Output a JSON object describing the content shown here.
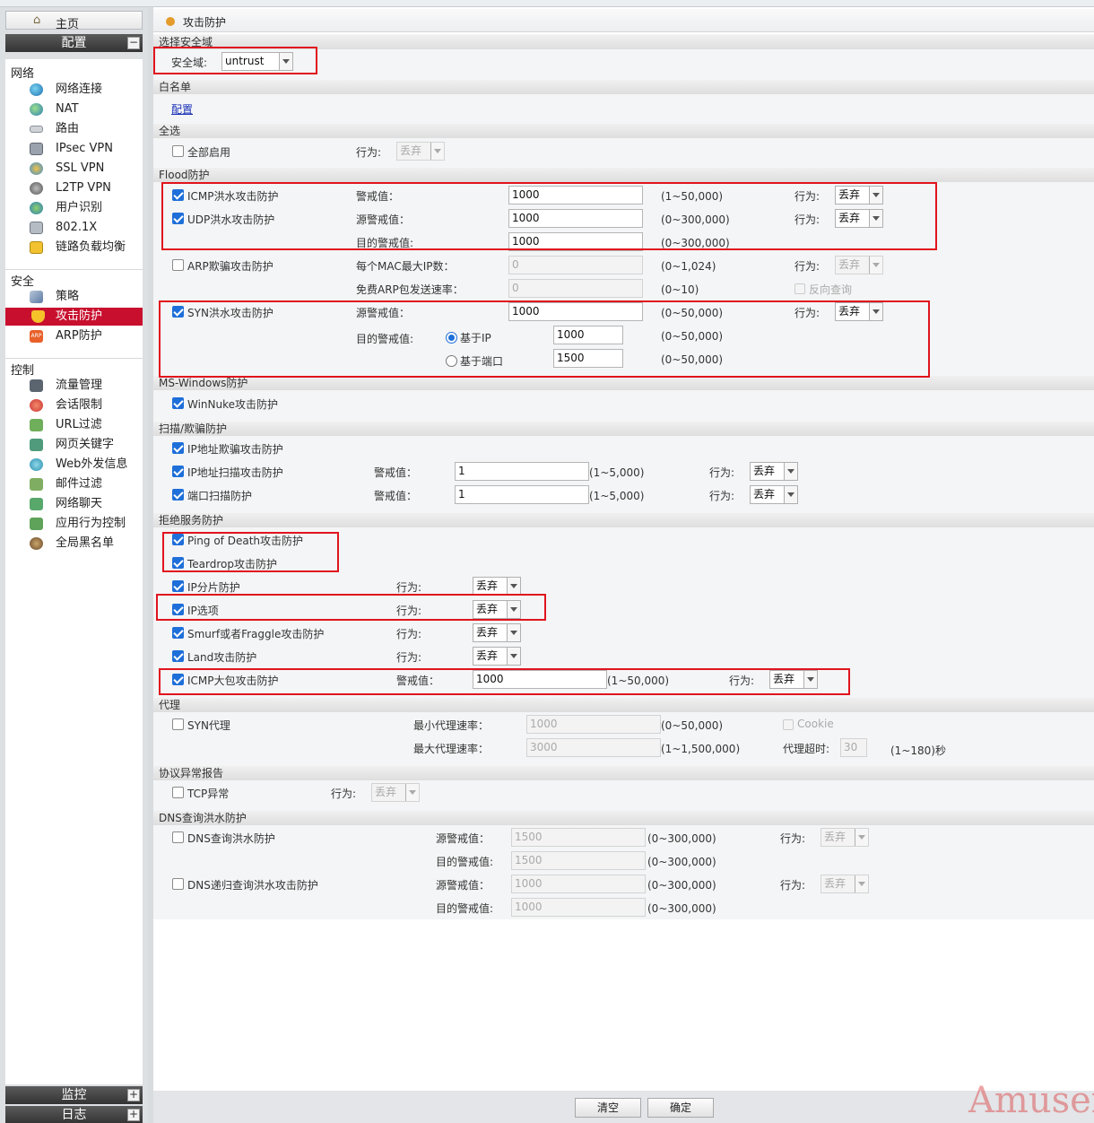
{
  "sidebar": {
    "home": "主页",
    "config_header": "配置",
    "groups": {
      "network": "网络",
      "security": "安全",
      "control": "控制"
    },
    "network_items": [
      {
        "label": "网络连接"
      },
      {
        "label": "NAT"
      },
      {
        "label": "路由"
      },
      {
        "label": "IPsec VPN"
      },
      {
        "label": "SSL VPN"
      },
      {
        "label": "L2TP VPN"
      },
      {
        "label": "用户识别"
      },
      {
        "label": "802.1X"
      },
      {
        "label": "链路负载均衡"
      }
    ],
    "security_items": [
      {
        "label": "策略"
      },
      {
        "label": "攻击防护"
      },
      {
        "label": "ARP防护"
      }
    ],
    "control_items": [
      {
        "label": "流量管理"
      },
      {
        "label": "会话限制"
      },
      {
        "label": "URL过滤"
      },
      {
        "label": "网页关键字"
      },
      {
        "label": "Web外发信息"
      },
      {
        "label": "邮件过滤"
      },
      {
        "label": "网络聊天"
      },
      {
        "label": "应用行为控制"
      },
      {
        "label": "全局黑名单"
      }
    ],
    "monitor_header": "监控",
    "log_header": "日志",
    "plus": "+",
    "minus": "−"
  },
  "main": {
    "title": "攻击防护",
    "zone": {
      "section": "选择安全域",
      "label": "安全域:",
      "value": "untrust"
    },
    "whitelist": {
      "section": "白名单",
      "link": "配置"
    },
    "all": {
      "section": "全选",
      "label": "全部启用",
      "action_label": "行为:",
      "action": "丢弃"
    },
    "flood": {
      "section": "Flood防护",
      "icmp": {
        "label": "ICMP洪水攻击防护",
        "threshold_label": "警戒值：",
        "value": "1000",
        "range": "(1~50,000)",
        "action_label": "行为:",
        "action": "丢弃"
      },
      "udp": {
        "label": "UDP洪水攻击防护",
        "src_label": "源警戒值：",
        "src_value": "1000",
        "src_range": "(0~300,000)",
        "dst_label": "目的警戒值:",
        "dst_value": "1000",
        "dst_range": "(0~300,000)",
        "action_label": "行为:",
        "action": "丢弃"
      },
      "arp": {
        "label": "ARP欺骗攻击防护",
        "mac_label": "每个MAC最大IP数：",
        "mac_value": "0",
        "mac_range": "(0~1,024)",
        "rate_label": "免费ARP包发送速率：",
        "rate_value": "0",
        "rate_range": "(0~10)",
        "action_label": "行为:",
        "action": "丢弃",
        "reverse": "反向查询"
      },
      "syn": {
        "label": "SYN洪水攻击防护",
        "src_label": "源警戒值：",
        "src_value": "1000",
        "src_range": "(0~50,000)",
        "dst_label": "目的警戒值:",
        "by_ip": "基于IP",
        "ip_value": "1000",
        "ip_range": "(0~50,000)",
        "by_port": "基于端口",
        "port_value": "1500",
        "port_range": "(0~50,000)",
        "action_label": "行为:",
        "action": "丢弃"
      }
    },
    "mswin": {
      "section": "MS-Windows防护",
      "winnuke": "WinNuke攻击防护"
    },
    "scan": {
      "section": "扫描/欺骗防护",
      "spoof": "IP地址欺骗攻击防护",
      "ipscan": {
        "label": "IP地址扫描攻击防护",
        "threshold_label": "警戒值：",
        "value": "1",
        "range": "(1~5,000)",
        "action_label": "行为:",
        "action": "丢弃"
      },
      "portscan": {
        "label": "端口扫描防护",
        "threshold_label": "警戒值：",
        "value": "1",
        "range": "(1~5,000)",
        "action_label": "行为:",
        "action": "丢弃"
      }
    },
    "dos": {
      "section": "拒绝服务防护",
      "ping": "Ping of Death攻击防护",
      "teardrop": "Teardrop攻击防护",
      "frag": {
        "label": "IP分片防护",
        "action_label": "行为:",
        "action": "丢弃"
      },
      "ipopt": {
        "label": "IP选项",
        "action_label": "行为:",
        "action": "丢弃"
      },
      "smurf": {
        "label": "Smurf或者Fraggle攻击防护",
        "action_label": "行为:",
        "action": "丢弃"
      },
      "land": {
        "label": "Land攻击防护",
        "action_label": "行为:",
        "action": "丢弃"
      },
      "icmpbig": {
        "label": "ICMP大包攻击防护",
        "threshold_label": "警戒值：",
        "value": "1000",
        "range": "(1~50,000)",
        "action_label": "行为:",
        "action": "丢弃"
      }
    },
    "proxy": {
      "section": "代理",
      "syn": "SYN代理",
      "min_label": "最小代理速率：",
      "min_value": "1000",
      "min_range": "(0~50,000)",
      "max_label": "最大代理速率：",
      "max_value": "3000",
      "max_range": "(1~1,500,000)",
      "cookie": "Cookie",
      "timeout_label": "代理超时:",
      "timeout_value": "30",
      "timeout_range": "(1~180)秒"
    },
    "proto": {
      "section": "协议异常报告",
      "tcp": "TCP异常",
      "action_label": "行为:",
      "action": "丢弃"
    },
    "dns": {
      "section": "DNS查询洪水防护",
      "query": {
        "label": "DNS查询洪水防护",
        "src_label": "源警戒值：",
        "src_value": "1500",
        "src_range": "(0~300,000)",
        "dst_label": "目的警戒值:",
        "dst_value": "1500",
        "dst_range": "(0~300,000)",
        "action_label": "行为:",
        "action": "丢弃"
      },
      "recursive": {
        "label": "DNS递归查询洪水攻击防护",
        "src_label": "源警戒值：",
        "src_value": "1000",
        "src_range": "(0~300,000)",
        "dst_label": "目的警戒值:",
        "dst_value": "1000",
        "dst_range": "(0~300,000)",
        "action_label": "行为:",
        "action": "丢弃"
      }
    },
    "buttons": {
      "clear": "清空",
      "ok": "确定"
    }
  },
  "watermark": "Amusem",
  "colors": {
    "active": "#c8102e",
    "highlight_box": "#e0141e",
    "checkbox": "#1e6fd9"
  }
}
